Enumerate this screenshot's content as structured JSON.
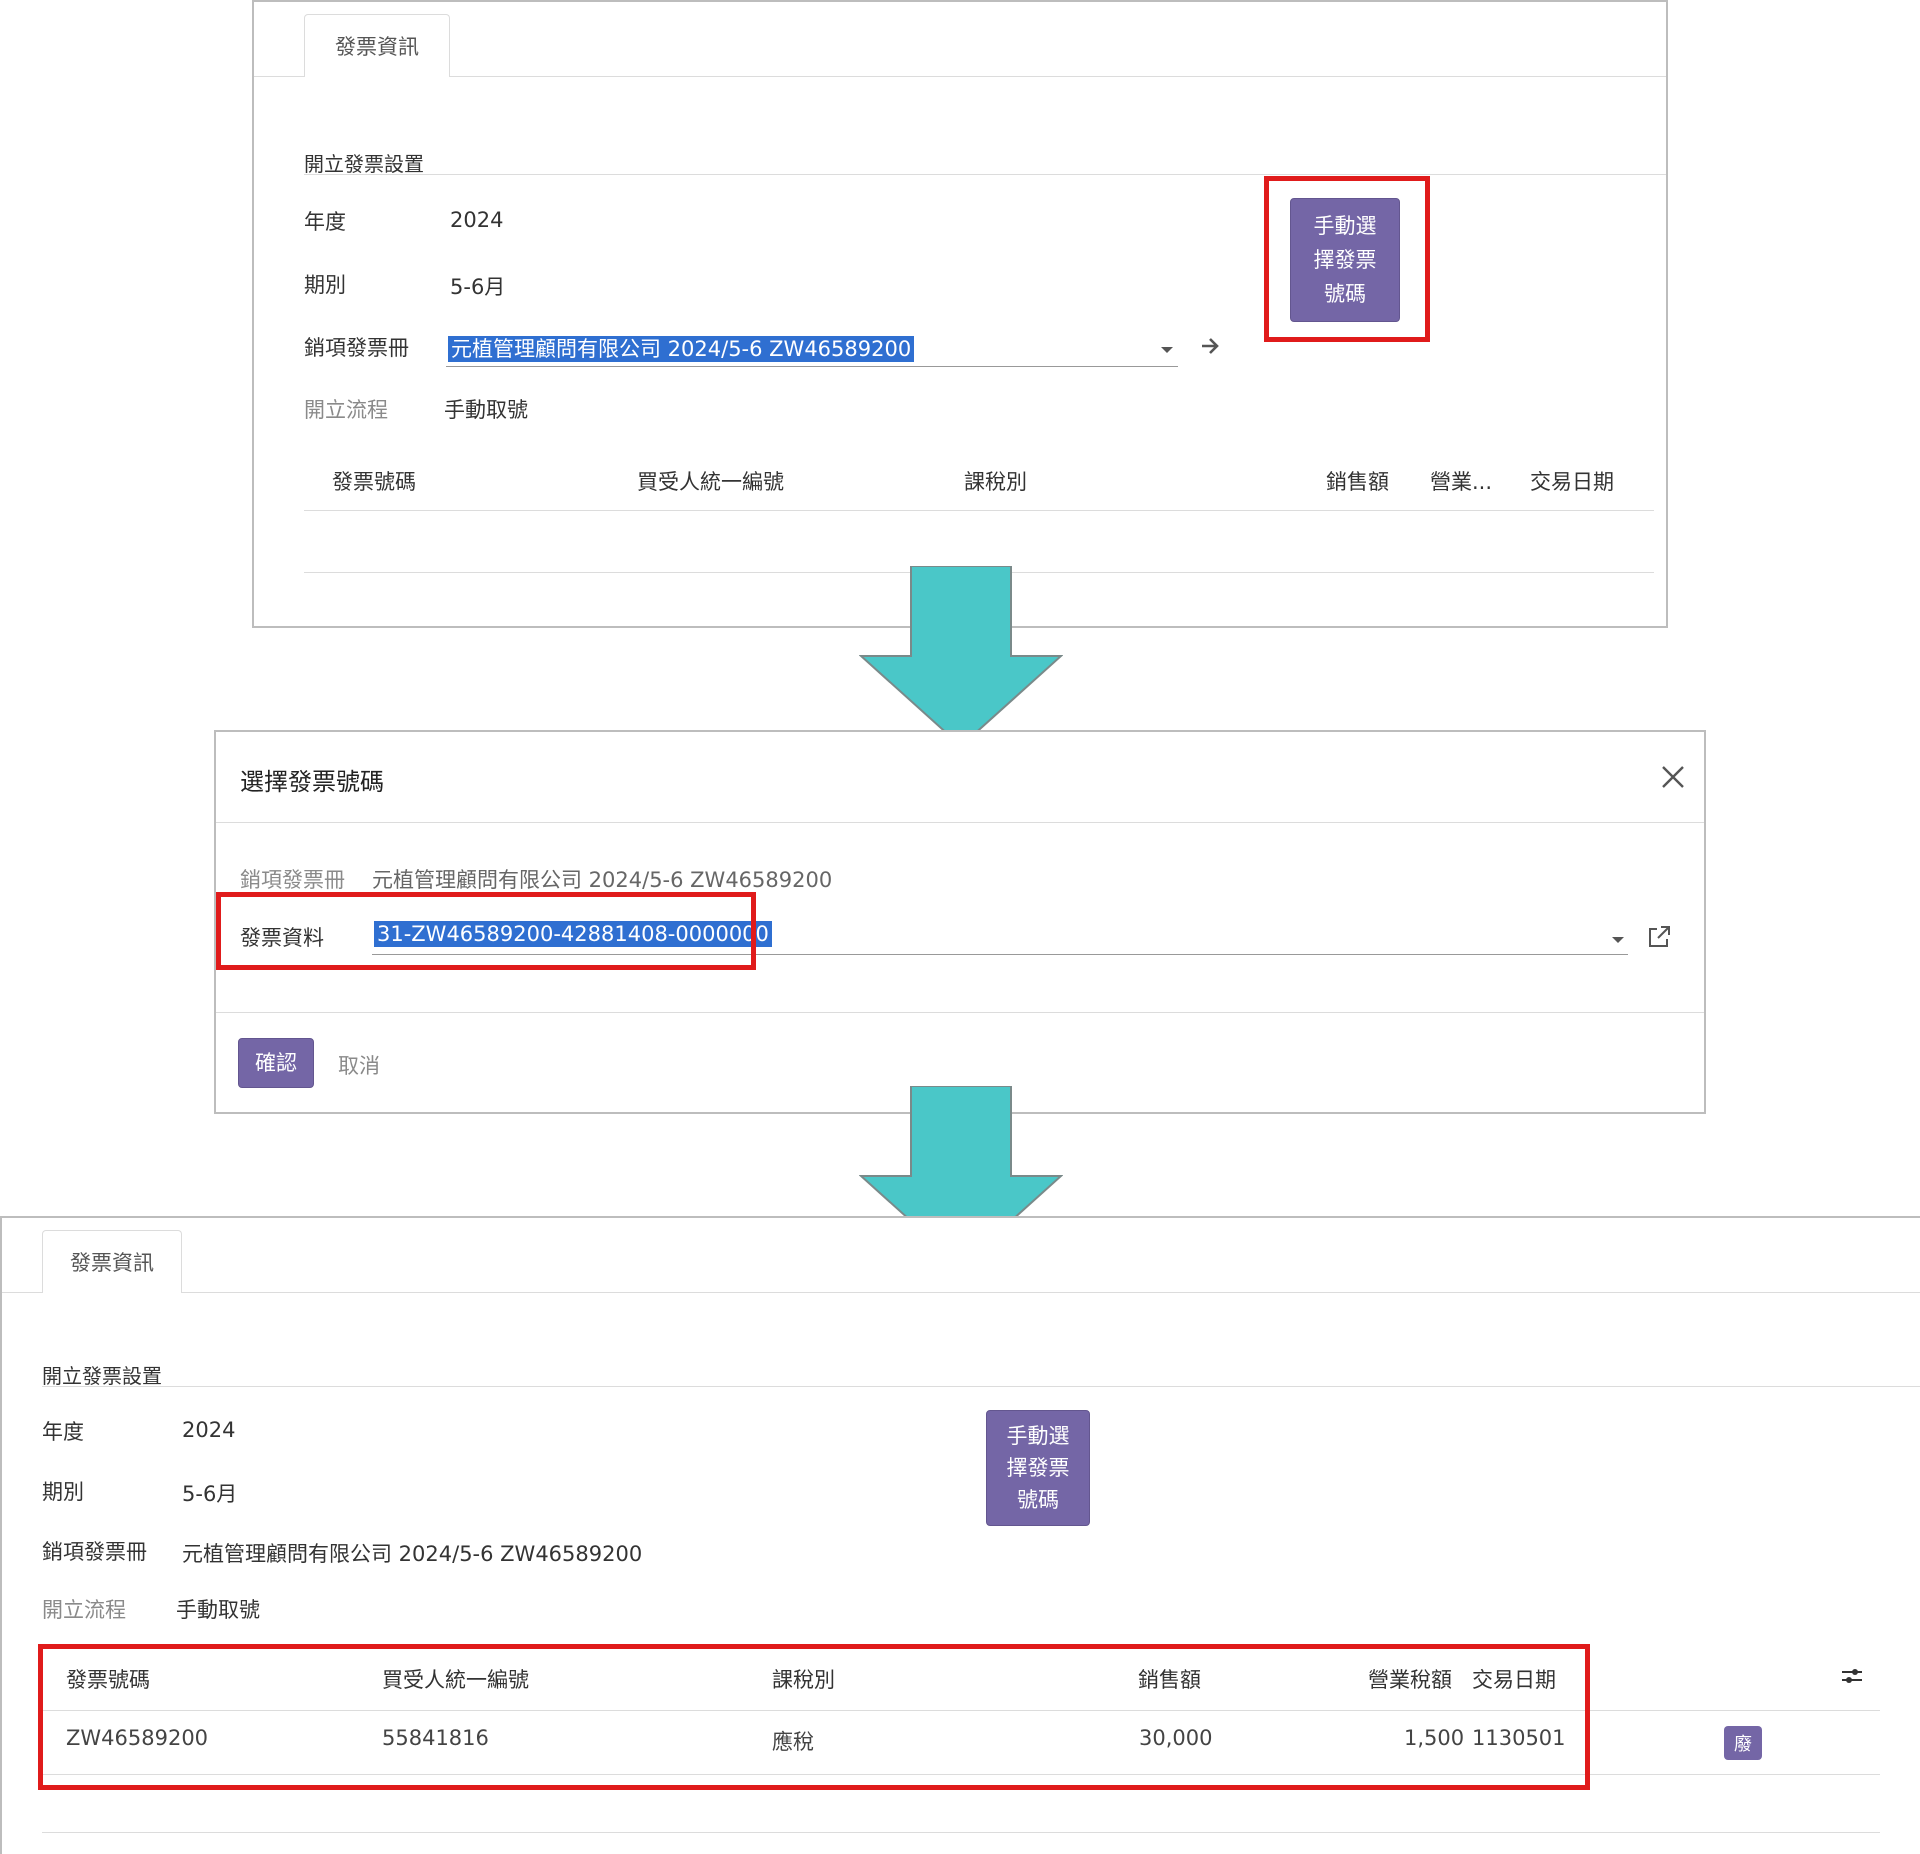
{
  "colors": {
    "accent": "#7466a6",
    "highlight_red": "#e01b1b",
    "arrow_teal": "#4ac7c8",
    "selection_blue": "#2f6fd1"
  },
  "top": {
    "tab_label": "發票資訊",
    "section_title": "開立發票設置",
    "fields": {
      "year_label": "年度",
      "year_value": "2024",
      "period_label": "期別",
      "period_value": "5-6月",
      "book_label": "銷項發票冊",
      "book_value": "元植管理顧問有限公司 2024/5-6 ZW46589200",
      "flow_label": "開立流程",
      "flow_value": "手動取號"
    },
    "manual_button": {
      "line1": "手動選",
      "line2": "擇發票",
      "line3": "號碼"
    },
    "table_headers": [
      "發票號碼",
      "買受人統一編號",
      "課稅別",
      "銷售額",
      "營業...",
      "交易日期"
    ]
  },
  "modal": {
    "title": "選擇發票號碼",
    "close_icon": "close-icon",
    "book_label": "銷項發票冊",
    "book_value": "元植管理顧問有限公司 2024/5-6 ZW46589200",
    "info_label": "發票資料",
    "info_value": "31-ZW46589200-42881408-0000000",
    "confirm_label": "確認",
    "cancel_label": "取消"
  },
  "bottom": {
    "tab_label": "發票資訊",
    "section_title": "開立發票設置",
    "fields": {
      "year_label": "年度",
      "year_value": "2024",
      "period_label": "期別",
      "period_value": "5-6月",
      "book_label": "銷項發票冊",
      "book_value": "元植管理顧問有限公司 2024/5-6 ZW46589200",
      "flow_label": "開立流程",
      "flow_value": "手動取號"
    },
    "manual_button": {
      "line1": "手動選",
      "line2": "擇發票",
      "line3": "號碼"
    },
    "table_headers": [
      "發票號碼",
      "買受人統一編號",
      "課稅別",
      "銷售額",
      "營業稅額",
      "交易日期"
    ],
    "row": {
      "invoice_no": "ZW46589200",
      "buyer_id": "55841816",
      "tax_type": "應稅",
      "sales": "30,000",
      "tax": "1,500",
      "date": "1130501",
      "void_badge": "廢"
    }
  }
}
